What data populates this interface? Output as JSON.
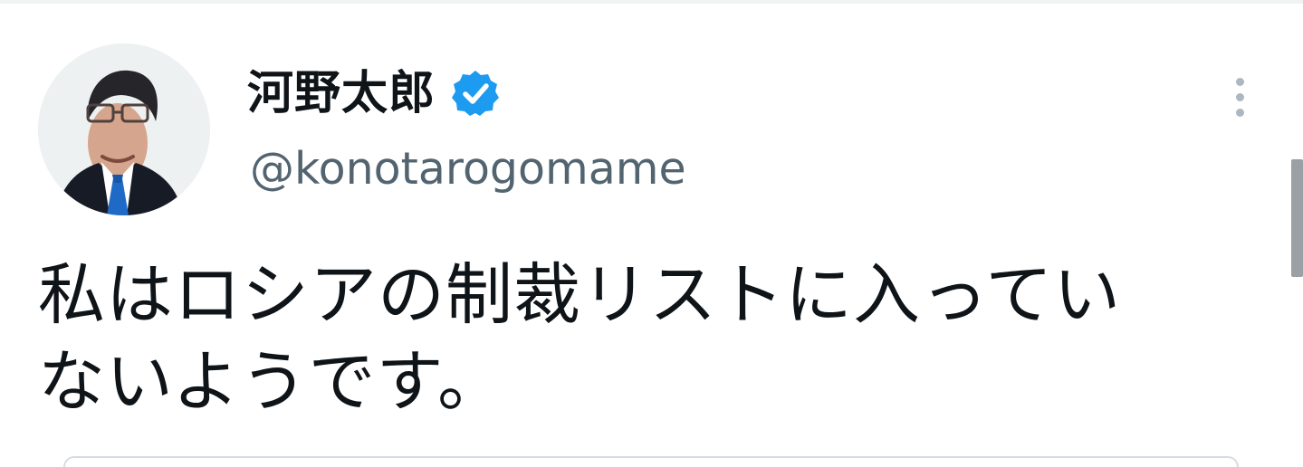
{
  "tweet": {
    "author": {
      "display_name": "河野太郎",
      "username": "@konotarogomame",
      "verified": true,
      "avatar_icon": "profile-photo"
    },
    "text": "私はロシアの制裁リストに入ってい\nないようです。",
    "more_icon": "more-vertical-icon"
  },
  "colors": {
    "text_primary": "#0f1419",
    "text_secondary": "#536471",
    "verified_blue": "#1d9bf0",
    "divider": "#eff3f4",
    "scrollbar": "#9aa0a4"
  }
}
